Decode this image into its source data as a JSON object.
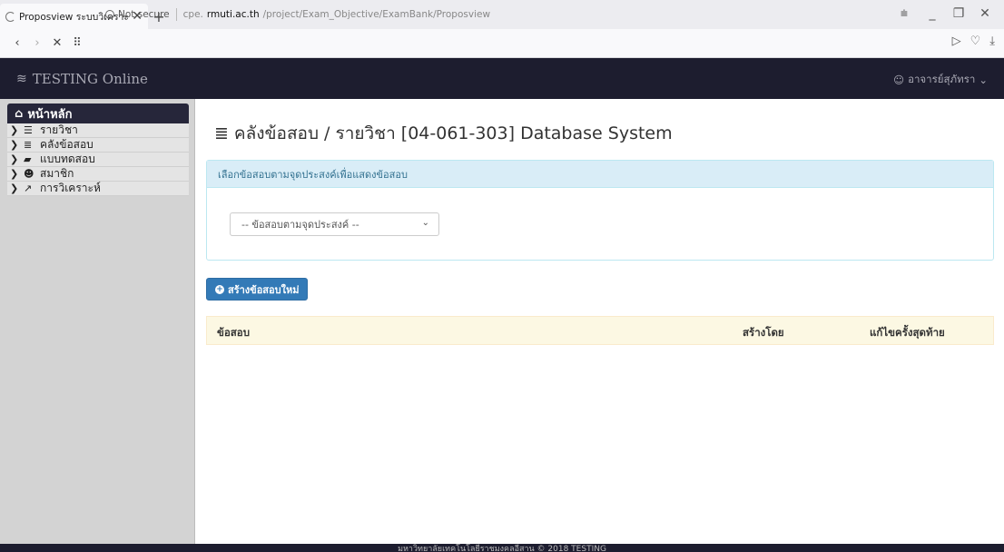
{
  "browser": {
    "tab_title": "Proposview ระบบวิเคราะห์ม",
    "tab_close": "✕",
    "new_tab": "+",
    "back": "‹",
    "forward": "›",
    "stop": "✕",
    "apps": "⠿",
    "security_label": "Not secure",
    "url_prefix": "cpe.",
    "url_host": "rmuti.ac.th",
    "url_path": "/project/Exam_Objective/ExamBank/Proposview",
    "win_menu": "⩧",
    "win_min": "_",
    "win_restore": "❐",
    "win_close": "✕",
    "send_icon": "▷",
    "heart_icon": "♡",
    "download_icon": "⤓"
  },
  "app": {
    "brand": "TESTING Online",
    "user": "อาจารย์สุภัทรา"
  },
  "sidebar": {
    "home": "หน้าหลัก",
    "items": [
      {
        "label": "รายวิชา",
        "icon": "list-icon"
      },
      {
        "label": "คลังข้อสอบ",
        "icon": "database-icon"
      },
      {
        "label": "แบบทดสอบ",
        "icon": "book-icon"
      },
      {
        "label": "สมาชิก",
        "icon": "users-icon"
      },
      {
        "label": "การวิเคราะห์",
        "icon": "line-chart-icon"
      }
    ]
  },
  "main": {
    "title": "คลังข้อสอบ / รายวิชา [04-061-303] Database System",
    "panel_heading": "เลือกข้อสอบตามจุดประสงค์เพื่อแสดงข้อสอบ",
    "select_value": "-- ข้อสอบตามจุดประสงค์ --",
    "create_button": "สร้างข้อสอบใหม่",
    "table_headers": [
      "ข้อสอบ",
      "สร้างโดย",
      "แก้ไขครั้งสุดท้าย"
    ]
  },
  "footer": {
    "text": "มหาวิทยาลัยเทคโนโลยีราชมงคลอีสาน © 2018 TESTING"
  },
  "colors": {
    "header_bg": "#1d1d2f",
    "sidebar_bg": "#d3d3d3",
    "primary": "#337ab7",
    "info_panel": "#d9edf7",
    "table_head": "#fcf8e3"
  }
}
